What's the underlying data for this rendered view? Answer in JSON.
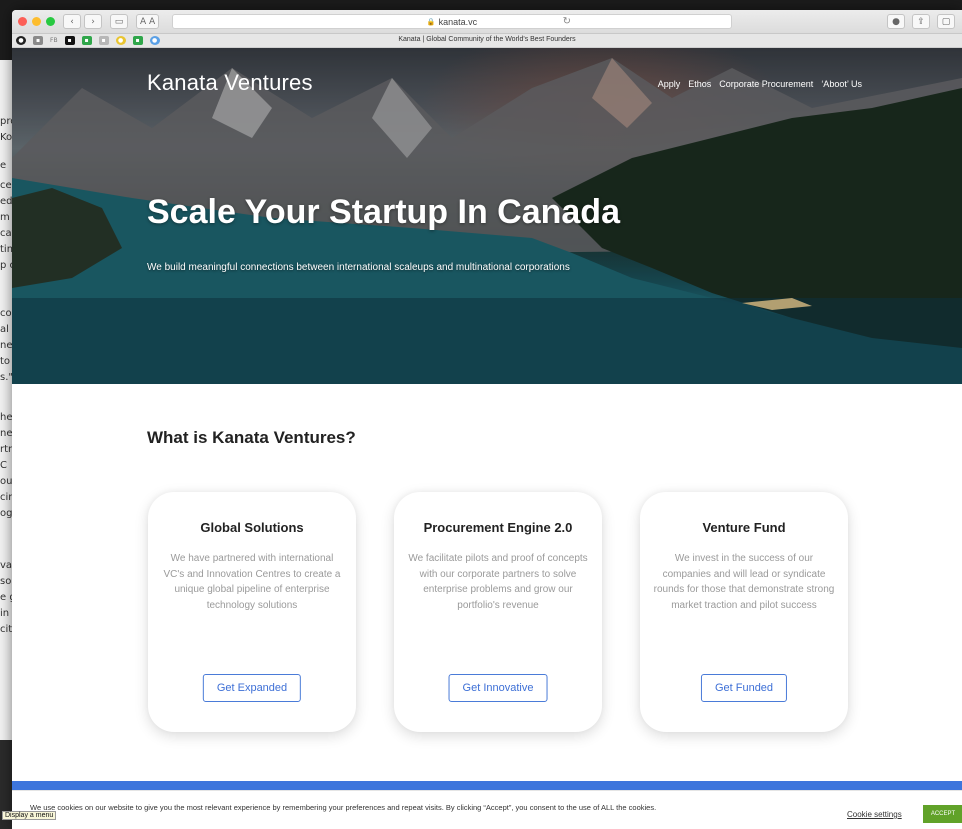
{
  "browser": {
    "url": "kanata.vc",
    "page_title": "Kanata | Global Community of the World's Best Founders",
    "reader_label": "A A",
    "bookmark_fb": "FB"
  },
  "background_window": {
    "lines": [
      "pro",
      "Kor",
      "e",
      "ced",
      "ed",
      "m",
      "cat",
      "tim",
      "p c",
      "co",
      "al s",
      "ne",
      "to",
      "s.\"",
      "he",
      "nes",
      "rtn",
      "C",
      "oug",
      "cing",
      "ogr",
      "vat",
      "so",
      "e g",
      "in",
      "city"
    ]
  },
  "site": {
    "brand": "Kanata Ventures",
    "nav": [
      "Apply",
      "Ethos",
      "Corporate Procurement",
      "‘Aboot’ Us"
    ],
    "hero_title": "Scale Your Startup In Canada",
    "hero_subtitle": "We build meaningful connections between international scaleups and multinational corporations",
    "section_title": "What is Kanata Ventures?",
    "cards": [
      {
        "title": "Global Solutions",
        "body": "We have partnered with international VC's and Innovation Centres to create a unique global pipeline of enterprise technology solutions",
        "cta": "Get Expanded"
      },
      {
        "title": "Procurement Engine 2.0",
        "body": "We facilitate pilots and proof of concepts with our corporate partners to solve enterprise problems and grow our portfolio's revenue",
        "cta": "Get Innovative"
      },
      {
        "title": "Venture Fund",
        "body": "We invest in the success of our companies and will lead or syndicate rounds for those that demonstrate strong market traction and pilot success",
        "cta": "Get Funded"
      }
    ]
  },
  "cookie_banner": {
    "text": "We use cookies on our website to give you the most relevant experience by remembering your preferences and repeat visits. By clicking “Accept”, you consent to the use of ALL the cookies.",
    "settings_label": "Cookie settings",
    "accept_label": "ACCEPT"
  },
  "tooltip": "Display a menu",
  "colors": {
    "accent_blue": "#3d75dc",
    "accept_green": "#61a229",
    "cta_border": "#4a7bd8"
  }
}
